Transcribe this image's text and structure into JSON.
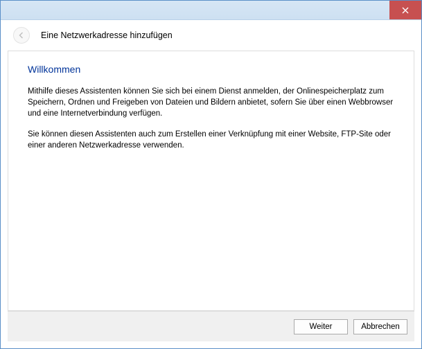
{
  "titlebar": {
    "close_label": "Close"
  },
  "header": {
    "wizard_title": "Eine Netzwerkadresse hinzufügen"
  },
  "content": {
    "heading": "Willkommen",
    "paragraph1": "Mithilfe dieses Assistenten können Sie sich bei einem Dienst anmelden, der Onlinespeicherplatz zum Speichern, Ordnen und Freigeben von Dateien und Bildern anbietet, sofern Sie über einen Webbrowser und eine Internetverbindung verfügen.",
    "paragraph2": "Sie können diesen Assistenten auch zum Erstellen einer Verknüpfung mit einer Website, FTP-Site oder einer anderen Netzwerkadresse verwenden."
  },
  "buttons": {
    "next": "Weiter",
    "cancel": "Abbrechen"
  }
}
